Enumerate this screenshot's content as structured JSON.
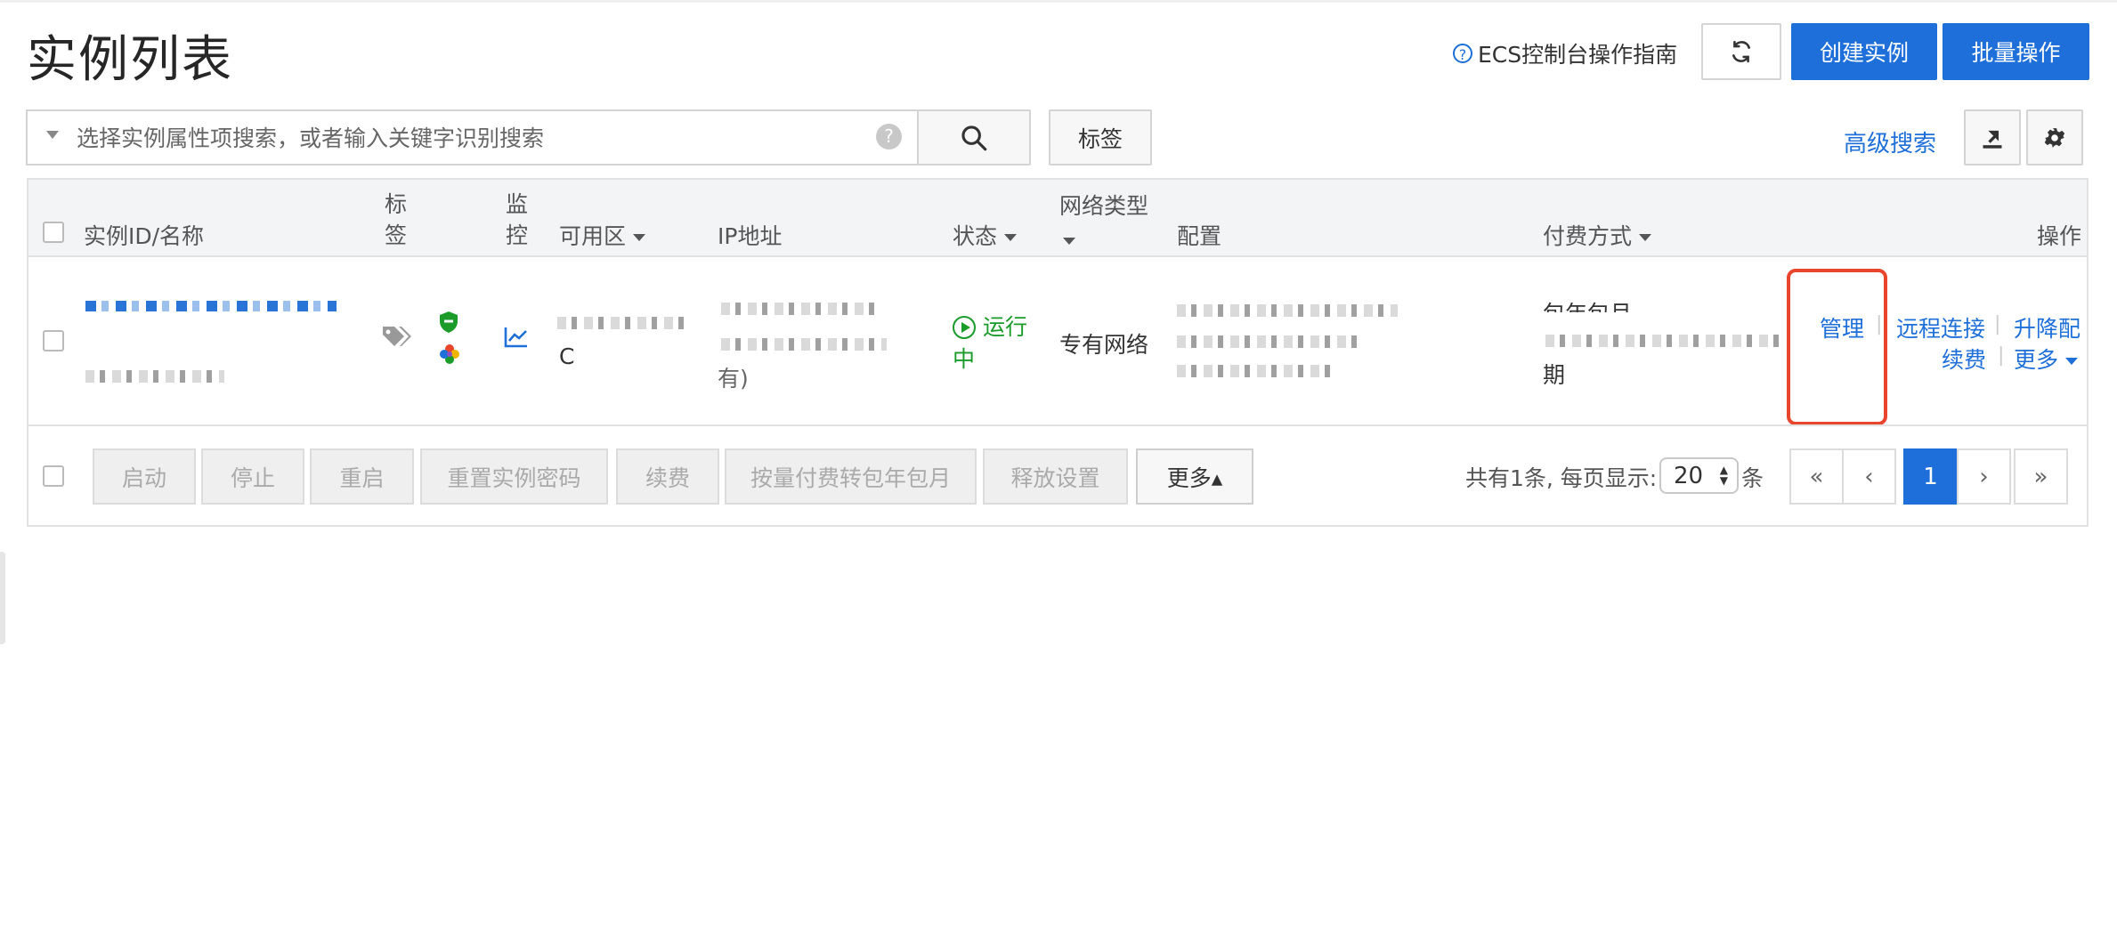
{
  "page": {
    "title": "实例列表"
  },
  "header": {
    "guide_link": "ECS控制台操作指南",
    "create_label": "创建实例",
    "batch_label": "批量操作"
  },
  "search": {
    "placeholder": "选择实例属性项搜索，或者输入关键字识别搜索",
    "help": "?",
    "tag_button": "标签",
    "advanced_link": "高级搜索"
  },
  "table": {
    "columns": {
      "id": "实例ID/名称",
      "tag": "标签",
      "monitor": "监控",
      "zone": "可用区",
      "ip": "IP地址",
      "status": "状态",
      "network": "网络类型",
      "config": "配置",
      "billing": "付费方式",
      "actions": "操作"
    },
    "rows": [
      {
        "zone_suffix": "C",
        "ip_suffix": "有)",
        "status": "运行中",
        "network": "专有网络",
        "billing_top": "包年包月",
        "billing_bottom": "期",
        "actions": {
          "manage": "管理",
          "remote": "远程连接",
          "upgrade": "升降配",
          "renew": "续费",
          "more": "更多"
        }
      }
    ]
  },
  "footer": {
    "buttons": [
      "启动",
      "停止",
      "重启",
      "重置实例密码",
      "续费",
      "按量付费转包年包月",
      "释放设置"
    ],
    "more_label": "更多▴",
    "summary": "共有1条, 每页显示:",
    "page_size": "20",
    "unit": "条",
    "pager": {
      "first": "«",
      "prev": "‹",
      "current": "1",
      "next": "›",
      "last": "»"
    }
  },
  "colors": {
    "primary": "#1e6fd9",
    "running": "#1a9b2a",
    "highlight": "#e8452c"
  }
}
